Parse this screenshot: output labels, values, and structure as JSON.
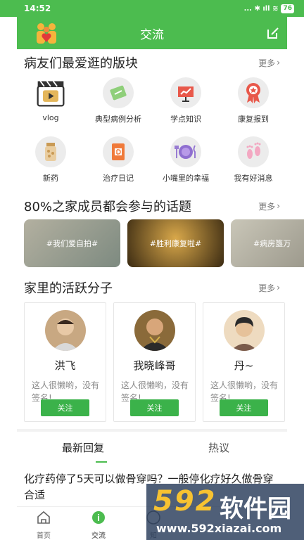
{
  "status_bar": {
    "time": "14:52",
    "icons": "... ✱ ıll ≋",
    "battery": "76"
  },
  "header": {
    "title": "交流",
    "logo_icon": "family-logo-icon",
    "edit_icon": "edit-icon"
  },
  "sections": {
    "forums": {
      "title": "病友们最爱逛的版块",
      "more": "更多"
    },
    "topics": {
      "title": "80%之家成员都会参与的话题",
      "more": "更多"
    },
    "members": {
      "title": "家里的活跃分子",
      "more": "更多"
    }
  },
  "categories": [
    {
      "label": "vlog",
      "icon": "video-clapper-icon"
    },
    {
      "label": "典型病例分析",
      "icon": "case-card-icon"
    },
    {
      "label": "学点知识",
      "icon": "presentation-board-icon"
    },
    {
      "label": "康复报到",
      "icon": "award-ribbon-icon"
    },
    {
      "label": "新药",
      "icon": "pill-bottle-icon"
    },
    {
      "label": "治疗日记",
      "icon": "diary-book-icon"
    },
    {
      "label": "小嘴里的幸福",
      "icon": "plate-utensils-icon"
    },
    {
      "label": "我有好消息",
      "icon": "baby-footprints-icon"
    }
  ],
  "topics": [
    {
      "label": "#我们爱自拍#",
      "color": "#9b9b8f"
    },
    {
      "label": "#胜利康复啦#",
      "color": "#6e5a2c"
    },
    {
      "label": "#病房簋万",
      "color": "#a9a9a0"
    }
  ],
  "members": [
    {
      "name": "洪飞",
      "signature": "这人很懒哟，没有签名!",
      "follow": "关注"
    },
    {
      "name": "我晓峰哥",
      "signature": "这人很懒哟，没有签名!",
      "follow": "关注"
    },
    {
      "name": "丹~",
      "signature": "这人很懒哟，没有签名!",
      "follow": "关注"
    }
  ],
  "tabs": [
    {
      "label": "最新回复",
      "active": true
    },
    {
      "label": "热议",
      "active": false
    }
  ],
  "post": {
    "title": "化疗药停了5天可以做骨穿吗？一般停化疗好久做骨穿合适"
  },
  "bottom_nav": [
    {
      "label": "首页",
      "icon": "home-icon"
    },
    {
      "label": "交流",
      "icon": "chat-icon",
      "active": true
    },
    {
      "label": "知",
      "icon": "knowledge-icon"
    }
  ],
  "watermark": {
    "brand": "592",
    "brand_cn": "软件园",
    "url": "www.592xiazai.com"
  },
  "colors": {
    "primary": "#4cbc4f",
    "follow": "#3bb24a",
    "text": "#222222",
    "muted": "#888888"
  }
}
